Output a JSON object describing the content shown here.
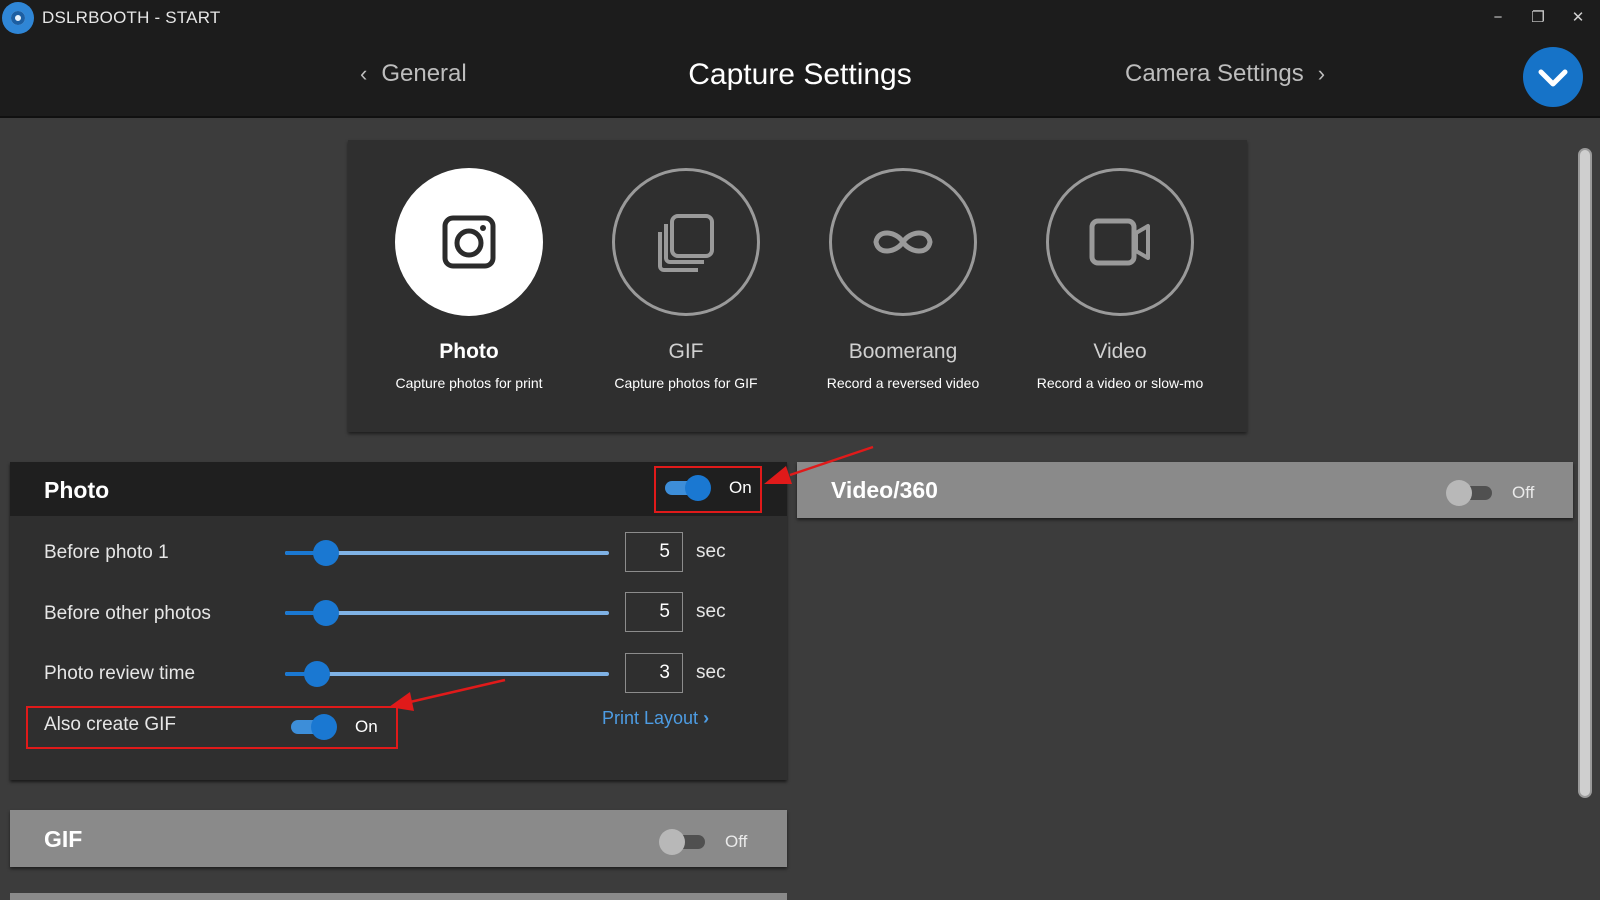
{
  "window": {
    "title": "DSLRBOOTH - START",
    "minimize_glyph": "−",
    "restore_glyph": "❐",
    "close_glyph": "✕"
  },
  "header": {
    "prev_label": "General",
    "title": "Capture Settings",
    "next_label": "Camera Settings",
    "prev_chevron": "‹",
    "next_chevron": "›"
  },
  "modes": [
    {
      "name": "Photo",
      "description": "Capture photos for print",
      "icon": "camera-icon",
      "active": true
    },
    {
      "name": "GIF",
      "description": "Capture photos for GIF",
      "icon": "stacked-photos-icon",
      "active": false
    },
    {
      "name": "Boomerang",
      "description": "Record a reversed video",
      "icon": "infinity-icon",
      "active": false
    },
    {
      "name": "Video",
      "description": "Record a video or slow-mo",
      "icon": "video-camera-icon",
      "active": false
    }
  ],
  "photo_section": {
    "title": "Photo",
    "toggle_state": "On",
    "rows": [
      {
        "label": "Before photo 1",
        "value": "5",
        "unit": "sec",
        "slider_fraction": 0.1
      },
      {
        "label": "Before other photos",
        "value": "5",
        "unit": "sec",
        "slider_fraction": 0.1
      },
      {
        "label": "Photo review time",
        "value": "3",
        "unit": "sec",
        "slider_fraction": 0.07
      }
    ],
    "also_create_gif": {
      "label": "Also create GIF",
      "state": "On"
    },
    "print_layout_link": "Print Layout",
    "print_layout_chevron": "›"
  },
  "video_section": {
    "title": "Video/360",
    "toggle_state": "Off"
  },
  "gif_section": {
    "title": "GIF",
    "toggle_state": "Off"
  },
  "colors": {
    "accent": "#1a78d2",
    "highlight": "#e01a1a",
    "link": "#4d9ce3"
  }
}
